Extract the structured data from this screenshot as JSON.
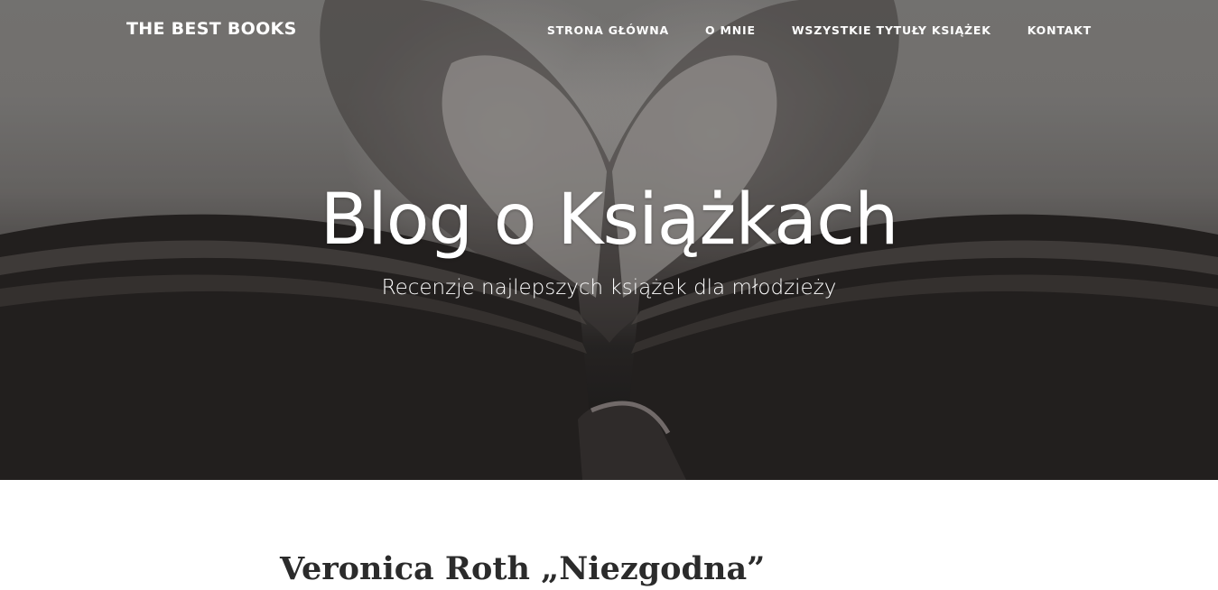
{
  "header": {
    "brand": "THE BEST BOOKS",
    "nav": [
      {
        "label": "STRONA GŁÓWNA"
      },
      {
        "label": "O MNIE"
      },
      {
        "label": "WSZYSTKIE TYTUŁY KSIĄŻEK"
      },
      {
        "label": "KONTAKT"
      }
    ]
  },
  "hero": {
    "title": "Blog o Książkach",
    "subtitle": "Recenzje najlepszych książek dla młodzieży"
  },
  "post": {
    "title": "Veronica Roth „Niezgodna”"
  }
}
